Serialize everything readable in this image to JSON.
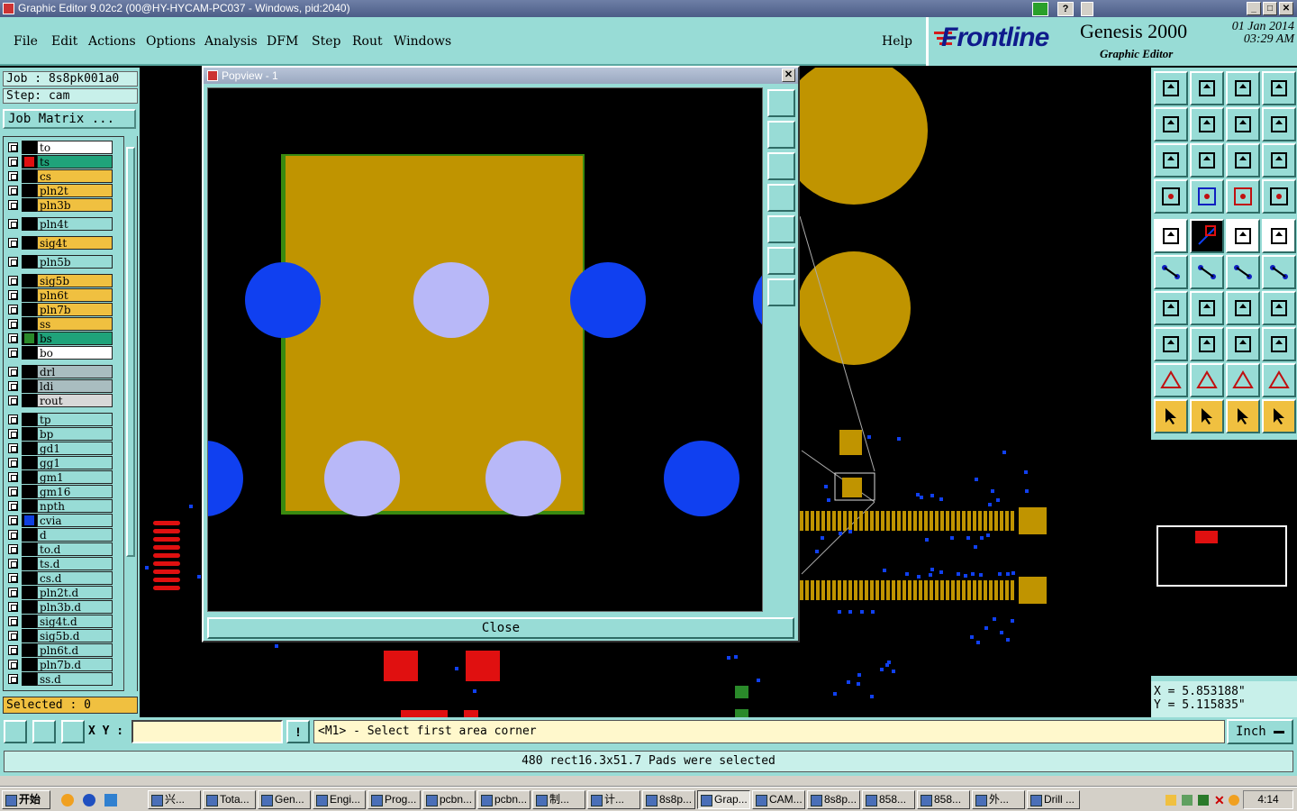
{
  "window": {
    "title": "Graphic Editor 9.02c2 (00@HY-HYCAM-PC037 - Windows, pid:2040)",
    "controls": [
      "_",
      "□",
      "✕"
    ]
  },
  "menu": {
    "items": [
      {
        "label": "File"
      },
      {
        "label": "Edit"
      },
      {
        "label": "Actions"
      },
      {
        "label": "Options"
      },
      {
        "label": "Analysis"
      },
      {
        "label": "DFM"
      },
      {
        "label": "Step"
      },
      {
        "label": "Rout"
      },
      {
        "label": "Windows"
      }
    ],
    "help": "Help"
  },
  "brand": {
    "logo": "Frontline",
    "product": "Genesis 2000",
    "subtitle": "Graphic Editor",
    "date": "01 Jan 2014",
    "time": "03:29 AM"
  },
  "job": {
    "job_label": "Job : 8s8pk001a0",
    "step_label": "Step: cam",
    "matrix_button": "Job Matrix ..."
  },
  "layers": [
    {
      "name": "to",
      "color": "#ffffff",
      "swatch": "#000000"
    },
    {
      "name": "ts",
      "color": "#1fa37a",
      "swatch": "#e01010",
      "active": true
    },
    {
      "name": "cs",
      "color": "#f0c040",
      "swatch": "#000000"
    },
    {
      "name": "pln2t",
      "color": "#f0c040",
      "swatch": "#000000"
    },
    {
      "name": "pln3b",
      "color": "#f0c040",
      "swatch": "#000000"
    },
    {
      "name": "pln4t",
      "color": "#98dcd6",
      "swatch": "#000000"
    },
    {
      "name": "sig4t",
      "color": "#f0c040",
      "swatch": "#000000"
    },
    {
      "name": "pln5b",
      "color": "#98dcd6",
      "swatch": "#000000"
    },
    {
      "name": "sig5b",
      "color": "#f0c040",
      "swatch": "#000000"
    },
    {
      "name": "pln6t",
      "color": "#f0c040",
      "swatch": "#000000"
    },
    {
      "name": "pln7b",
      "color": "#f0c040",
      "swatch": "#000000"
    },
    {
      "name": "ss",
      "color": "#f0c040",
      "swatch": "#000000"
    },
    {
      "name": "bs",
      "color": "#1fa37a",
      "swatch": "#2a8a2a"
    },
    {
      "name": "bo",
      "color": "#ffffff",
      "swatch": "#000000"
    },
    {
      "name": "drl",
      "color": "#a9bdc0",
      "swatch": "#000000"
    },
    {
      "name": "ldi",
      "color": "#a9bdc0",
      "swatch": "#000000"
    },
    {
      "name": "rout",
      "color": "#d8d8d8",
      "swatch": "#000000"
    },
    {
      "name": "tp",
      "color": "#98dcd6",
      "swatch": "#000000"
    },
    {
      "name": "bp",
      "color": "#98dcd6",
      "swatch": "#000000"
    },
    {
      "name": "gd1",
      "color": "#98dcd6",
      "swatch": "#000000"
    },
    {
      "name": "gg1",
      "color": "#98dcd6",
      "swatch": "#000000"
    },
    {
      "name": "gm1",
      "color": "#98dcd6",
      "swatch": "#000000"
    },
    {
      "name": "gm16",
      "color": "#98dcd6",
      "swatch": "#000000"
    },
    {
      "name": "npth",
      "color": "#98dcd6",
      "swatch": "#000000"
    },
    {
      "name": "cvia",
      "color": "#98dcd6",
      "swatch": "#1040e0"
    },
    {
      "name": "d",
      "color": "#98dcd6",
      "swatch": "#000000"
    },
    {
      "name": "to.d",
      "color": "#98dcd6",
      "swatch": "#000000"
    },
    {
      "name": "ts.d",
      "color": "#98dcd6",
      "swatch": "#000000"
    },
    {
      "name": "cs.d",
      "color": "#98dcd6",
      "swatch": "#000000"
    },
    {
      "name": "pln2t.d",
      "color": "#98dcd6",
      "swatch": "#000000"
    },
    {
      "name": "pln3b.d",
      "color": "#98dcd6",
      "swatch": "#000000"
    },
    {
      "name": "sig4t.d",
      "color": "#98dcd6",
      "swatch": "#000000"
    },
    {
      "name": "sig5b.d",
      "color": "#98dcd6",
      "swatch": "#000000"
    },
    {
      "name": "pln6t.d",
      "color": "#98dcd6",
      "swatch": "#000000"
    },
    {
      "name": "pln7b.d",
      "color": "#98dcd6",
      "swatch": "#000000"
    },
    {
      "name": "ss.d",
      "color": "#98dcd6",
      "swatch": "#000000"
    }
  ],
  "selected_label": "Selected : 0",
  "popview": {
    "title": "Popview - 1",
    "close_button": "Close"
  },
  "coords": {
    "x": "X = 5.853188\"",
    "y": "Y = 5.115835\""
  },
  "command": {
    "xy_label": "X Y :",
    "xy_value": "",
    "prompt": "<M1> - Select first area corner",
    "unit": "Inch"
  },
  "status_message": "480 rect16.3x51.7 Pads were selected",
  "taskbar": {
    "start": "开始",
    "items": [
      {
        "label": "兴..."
      },
      {
        "label": "Tota..."
      },
      {
        "label": "Gen..."
      },
      {
        "label": "Engi..."
      },
      {
        "label": "Prog..."
      },
      {
        "label": "pcbn..."
      },
      {
        "label": "pcbn..."
      },
      {
        "label": "制..."
      },
      {
        "label": "计..."
      },
      {
        "label": "8s8p..."
      },
      {
        "label": "Grap...",
        "active": true
      },
      {
        "label": "CAM..."
      },
      {
        "label": "8s8p..."
      },
      {
        "label": "858..."
      },
      {
        "label": "858..."
      },
      {
        "label": "外..."
      },
      {
        "label": "Drill ..."
      }
    ],
    "clock": "4:14"
  },
  "colors": {
    "panel": "#98dcd6",
    "copper": "#c09400",
    "via": "#1040f0",
    "drill": "#b8b8f8",
    "ts_pad": "#e01010",
    "green_edge": "#3a8a10"
  }
}
